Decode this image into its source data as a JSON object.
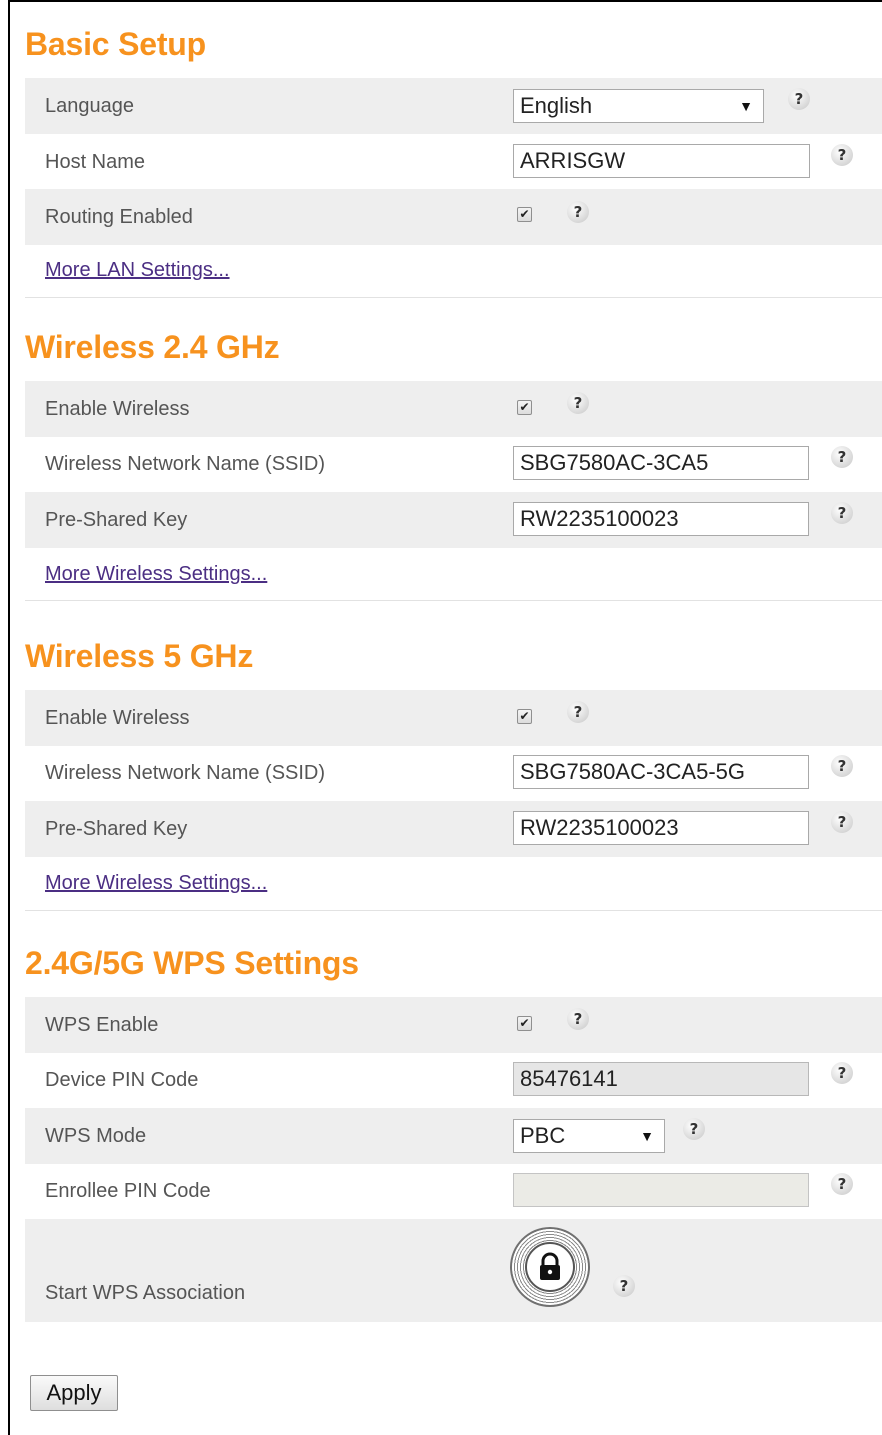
{
  "basic": {
    "title": "Basic Setup",
    "language_label": "Language",
    "language_value": "English",
    "host_label": "Host Name",
    "host_value": "ARRISGW",
    "routing_label": "Routing Enabled",
    "routing_checked": true,
    "more_link": "More LAN Settings..."
  },
  "wireless24": {
    "title": "Wireless 2.4 GHz",
    "enable_label": "Enable Wireless",
    "enable_checked": true,
    "ssid_label": "Wireless Network Name (SSID)",
    "ssid_value": "SBG7580AC-3CA5",
    "psk_label": "Pre-Shared Key",
    "psk_value": "RW2235100023",
    "more_link": "More Wireless Settings..."
  },
  "wireless5": {
    "title": "Wireless 5 GHz",
    "enable_label": "Enable Wireless",
    "enable_checked": true,
    "ssid_label": "Wireless Network Name (SSID)",
    "ssid_value": "SBG7580AC-3CA5-5G",
    "psk_label": "Pre-Shared Key",
    "psk_value": "RW2235100023",
    "more_link": "More Wireless Settings..."
  },
  "wps": {
    "title": "2.4G/5G WPS Settings",
    "enable_label": "WPS Enable",
    "enable_checked": true,
    "pin_label": "Device PIN Code",
    "pin_value": "85476141",
    "mode_label": "WPS Mode",
    "mode_value": "PBC",
    "enrollee_label": "Enrollee PIN Code",
    "enrollee_value": "",
    "start_label": "Start WPS Association"
  },
  "icons": {
    "help": "?",
    "check": "✔",
    "dropdown": "▼"
  },
  "apply_label": "Apply",
  "colors": {
    "section_title": "#f7921e",
    "row_shade": "#eeeeee",
    "link": "#4b2e83"
  }
}
